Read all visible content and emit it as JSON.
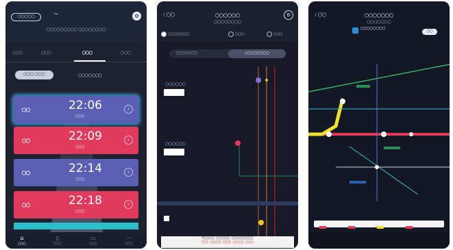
{
  "colors": {
    "card_blue": "#5b5fb4",
    "card_red": "#e03a5c",
    "map_yellow": "#f2e02b",
    "map_red": "#e43a55",
    "map_green": "#39b26a",
    "map_cyan": "#36c1d8"
  },
  "screen1": {
    "search_label": "〇〇〇〇〇",
    "logo": "∼",
    "subtitle": "〇〇〇〇〇〇〇〇〇 〇〇〇〇〇〇〇〇",
    "tabs": [
      {
        "label": "〇〇〇",
        "active": false
      },
      {
        "label": "〇〇〇",
        "active": false
      },
      {
        "label": "〇〇〇",
        "active": true
      },
      {
        "label": "〇〇〇",
        "active": false
      }
    ],
    "toggle_on": "〇〇〇 〇〇〇",
    "toggle_off": "〇〇〇〇〇〇〇",
    "departures": [
      {
        "kind": "〇〇",
        "time": "22:06",
        "dest": "〇〇〇",
        "style": "blue"
      },
      {
        "kind": "〇〇",
        "time": "22:09",
        "dest": "〇〇〇",
        "style": "red"
      },
      {
        "kind": "〇〇",
        "time": "22:14",
        "dest": "〇〇〇",
        "style": "blue"
      },
      {
        "kind": "〇〇",
        "time": "22:18",
        "dest": "〇〇〇",
        "style": "red"
      }
    ],
    "nav": [
      {
        "icon": "home-icon",
        "label": "〇〇〇",
        "active": true
      },
      {
        "icon": "doc-icon",
        "label": "〇〇〇",
        "active": false
      },
      {
        "icon": "card-icon",
        "label": "〇〇〇",
        "active": false
      },
      {
        "icon": "more-icon",
        "label": "〇〇〇",
        "active": false
      }
    ]
  },
  "screen2": {
    "back_label": "〈 〇〇",
    "title": "〇〇〇〇〇〇",
    "subtitle": "〇〇〇〇〇〇〇〇",
    "radio": [
      "〇〇〇〇〇〇〇",
      "〇〇〇",
      "〇〇〇"
    ],
    "seg_a": "〇〇〇〇〇〇〇",
    "seg_b": "〇〇〇〇〇〇〇〇",
    "train_labels": [
      "〇〇〇〇〇〇",
      "〇〇〇〇〇〇"
    ],
    "footer_line1": "T〇〇〇〇 〇〇〇〇〇 〇〇〇〇〇〇〇〇",
    "footer_line2": "T〇〇 〇〇〇〇 〇〇〇 〇〇〇〇 〇〇〇"
  },
  "screen3": {
    "back_label": "〈 〇〇",
    "title": "〇〇〇〇〇〇〇",
    "subtitle": "〇〇〇〇〇〇〇",
    "line_name": "〇〇〇〇〇〇〇〇",
    "button_label": "〇〇"
  }
}
